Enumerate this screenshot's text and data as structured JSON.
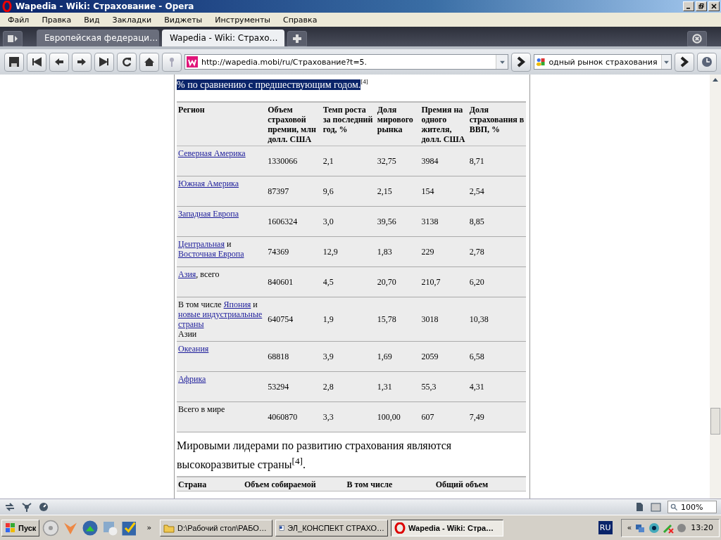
{
  "window": {
    "title": "Wapedia - Wiki: Страхование - Opera"
  },
  "menu": [
    "Файл",
    "Правка",
    "Вид",
    "Закладки",
    "Виджеты",
    "Инструменты",
    "Справка"
  ],
  "tabs": [
    {
      "label": "Европейская федераци…",
      "selected": false
    },
    {
      "label": "Wapedia - Wiki: Страхо…",
      "selected": true
    }
  ],
  "address": {
    "value": "http://wapedia.mobi/ru/Страхование?t=5."
  },
  "search": {
    "value": "одный рынок страхования"
  },
  "content": {
    "lead": {
      "text": "% по сравнению с предшествующим годом.",
      "selected": true,
      "note": "[4]"
    },
    "table": {
      "columns": [
        "Регион",
        "Объем страховой премии, млн долл. США",
        "Темп роста за последний год, %",
        "Доля мирового рынка",
        "Премия на одного жителя, долл. США",
        "Доля страхования в ВВП, %"
      ],
      "rows": [
        {
          "cells": [
            [
              {
                "text": "Северная Америка",
                "link": true
              }
            ],
            "1330066",
            "2,1",
            "32,75",
            "3984",
            "8,71"
          ]
        },
        {
          "cells": [
            [
              {
                "text": "Южная Америка",
                "link": true
              }
            ],
            "87397",
            "9,6",
            "2,15",
            "154",
            "2,54"
          ]
        },
        {
          "cells": [
            [
              {
                "text": "Западная Европа",
                "link": true
              }
            ],
            "1606324",
            "3,0",
            "39,56",
            "3138",
            "8,85"
          ]
        },
        {
          "cells": [
            [
              {
                "text": "Центральная",
                "link": true
              },
              {
                "text": " и ",
                "link": false
              },
              {
                "text": "Восточная Европа",
                "link": true
              }
            ],
            "74369",
            "12,9",
            "1,83",
            "229",
            "2,78"
          ]
        },
        {
          "cells": [
            [
              {
                "text": "Азия",
                "link": true
              },
              {
                "text": ", всего",
                "link": false
              }
            ],
            "840601",
            "4,5",
            "20,70",
            "210,7",
            "6,20"
          ]
        },
        {
          "cells": [
            [
              {
                "text": "В том числе ",
                "link": false
              },
              {
                "text": "Япония",
                "link": true
              },
              {
                "text": " и ",
                "link": false
              },
              {
                "text": "новые индустриальные страны",
                "link": true
              },
              {
                "text": " Азии",
                "link": false
              }
            ],
            "640754",
            "1,9",
            "15,78",
            "3018",
            "10,38"
          ]
        },
        {
          "cells": [
            [
              {
                "text": "Океания",
                "link": true
              }
            ],
            "68818",
            "3,9",
            "1,69",
            "2059",
            "6,58"
          ]
        },
        {
          "cells": [
            [
              {
                "text": "Африка",
                "link": true
              }
            ],
            "53294",
            "2,8",
            "1,31",
            "55,3",
            "4,31"
          ]
        },
        {
          "cells": [
            [
              {
                "text": "Всего в мире",
                "link": false
              }
            ],
            "4060870",
            "3,3",
            "100,00",
            "607",
            "7,49"
          ]
        }
      ]
    },
    "paragraph": "Мировыми лидерами по развитию страхования являются высокоразвитые страны$^{[4]}$.",
    "table2": {
      "columns": [
        "Страна",
        "Объем собираемой",
        "В том числе",
        "Общий объем"
      ]
    }
  },
  "status_bar": {
    "zoom": "100%"
  },
  "taskbar": {
    "start": "Пуск",
    "chevron": "»",
    "windows": [
      {
        "label": "D:\\Рабочий стол\\РАБО…",
        "selected": false
      },
      {
        "label": "ЭЛ_КОНСПЕКТ СТРАХО…",
        "selected": false
      },
      {
        "label": "Wapedia - Wiki: Стра…",
        "selected": true
      }
    ],
    "language": "RU",
    "tray_chevron": "«",
    "clock": "13:20"
  }
}
